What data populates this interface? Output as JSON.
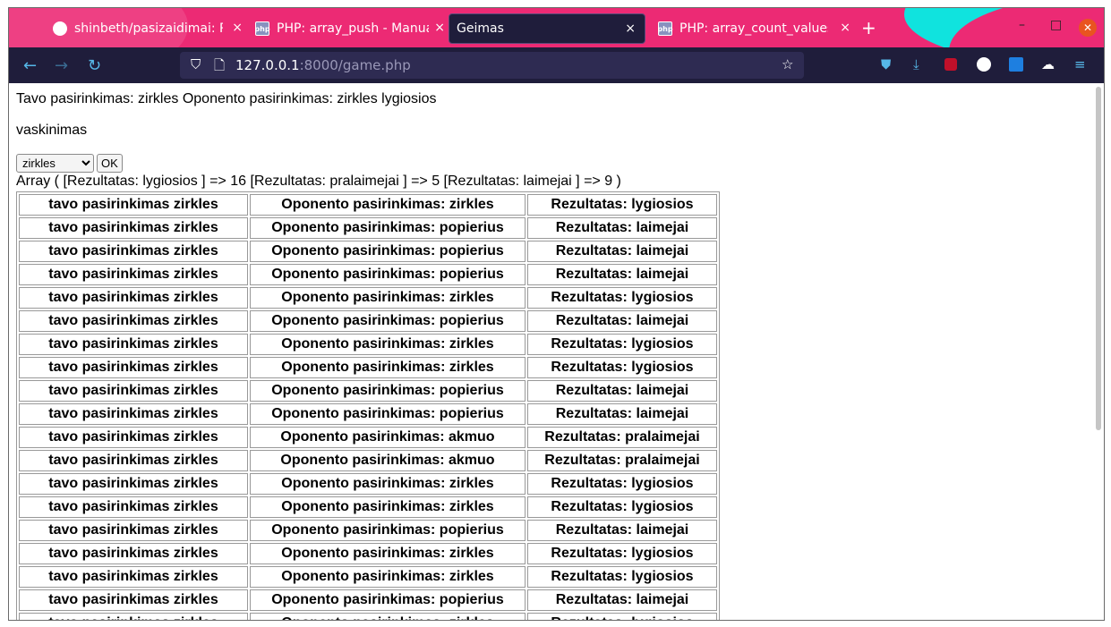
{
  "tabs": [
    {
      "label": "shinbeth/pasizaidimai: Pl",
      "icon": "github-icon",
      "close": "×",
      "active": false
    },
    {
      "label": "PHP: array_push - Manual",
      "icon": "php-icon",
      "close": "×",
      "active": false
    },
    {
      "label": "Geimas",
      "icon": "",
      "close": "×",
      "active": true
    },
    {
      "label": "PHP: array_count_values",
      "icon": "php-icon",
      "close": "×",
      "active": false
    }
  ],
  "new_tab": "+",
  "window_controls": {
    "minimize": "–",
    "maximize": "□",
    "close": "✕"
  },
  "nav": {
    "back": "←",
    "forward": "→",
    "reload": "↻"
  },
  "url": {
    "host": "127.0.0.1",
    "rest": ":8000/game.php"
  },
  "toolbar_icons": [
    "pocket-icon",
    "download-icon",
    "ublock-icon",
    "s-extension-icon",
    "s-square-extension-icon",
    "extension-icon",
    "menu-icon"
  ],
  "page": {
    "line1": "Tavo pasirinkimas: zirkles Oponento pasirinkimas: zirkles lygiosios",
    "line2": "vaskinimas",
    "select_value": "zirkles",
    "ok_label": "OK",
    "array_line": "Array ( [Rezultatas: lygiosios ] => 16 [Rezultatas: pralaimejai ] => 5 [Rezultatas: laimejai ] => 9 )"
  },
  "table_rows": [
    [
      "tavo pasirinkimas zirkles",
      "Oponento pasirinkimas: zirkles",
      "Rezultatas: lygiosios"
    ],
    [
      "tavo pasirinkimas zirkles",
      "Oponento pasirinkimas: popierius",
      "Rezultatas: laimejai"
    ],
    [
      "tavo pasirinkimas zirkles",
      "Oponento pasirinkimas: popierius",
      "Rezultatas: laimejai"
    ],
    [
      "tavo pasirinkimas zirkles",
      "Oponento pasirinkimas: popierius",
      "Rezultatas: laimejai"
    ],
    [
      "tavo pasirinkimas zirkles",
      "Oponento pasirinkimas: zirkles",
      "Rezultatas: lygiosios"
    ],
    [
      "tavo pasirinkimas zirkles",
      "Oponento pasirinkimas: popierius",
      "Rezultatas: laimejai"
    ],
    [
      "tavo pasirinkimas zirkles",
      "Oponento pasirinkimas: zirkles",
      "Rezultatas: lygiosios"
    ],
    [
      "tavo pasirinkimas zirkles",
      "Oponento pasirinkimas: zirkles",
      "Rezultatas: lygiosios"
    ],
    [
      "tavo pasirinkimas zirkles",
      "Oponento pasirinkimas: popierius",
      "Rezultatas: laimejai"
    ],
    [
      "tavo pasirinkimas zirkles",
      "Oponento pasirinkimas: popierius",
      "Rezultatas: laimejai"
    ],
    [
      "tavo pasirinkimas zirkles",
      "Oponento pasirinkimas: akmuo",
      "Rezultatas: pralaimejai"
    ],
    [
      "tavo pasirinkimas zirkles",
      "Oponento pasirinkimas: akmuo",
      "Rezultatas: pralaimejai"
    ],
    [
      "tavo pasirinkimas zirkles",
      "Oponento pasirinkimas: zirkles",
      "Rezultatas: lygiosios"
    ],
    [
      "tavo pasirinkimas zirkles",
      "Oponento pasirinkimas: zirkles",
      "Rezultatas: lygiosios"
    ],
    [
      "tavo pasirinkimas zirkles",
      "Oponento pasirinkimas: popierius",
      "Rezultatas: laimejai"
    ],
    [
      "tavo pasirinkimas zirkles",
      "Oponento pasirinkimas: zirkles",
      "Rezultatas: lygiosios"
    ],
    [
      "tavo pasirinkimas zirkles",
      "Oponento pasirinkimas: zirkles",
      "Rezultatas: lygiosios"
    ],
    [
      "tavo pasirinkimas zirkles",
      "Oponento pasirinkimas: popierius",
      "Rezultatas: laimejai"
    ],
    [
      "tavo pasirinkimas zirkles",
      "Oponento pasirinkimas: zirkles",
      "Rezultatas: lygiosios"
    ]
  ],
  "colors": {
    "tabbar": "#ec2a74",
    "navbar": "#1f1d3b",
    "accent": "#56b8e8",
    "teal": "#10e3de"
  }
}
